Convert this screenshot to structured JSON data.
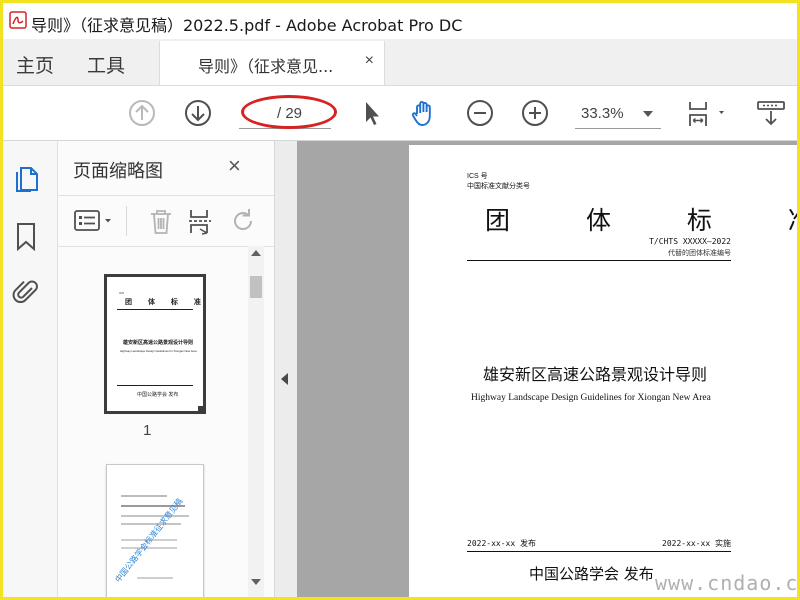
{
  "window": {
    "title": "导则》（征求意见稿）2022.5.pdf - Adobe Acrobat Pro DC"
  },
  "menubar": {
    "home_label": "主页",
    "tools_label": "工具",
    "doc_tab_label": "导则》（征求意见...",
    "doc_tab_close": "×"
  },
  "toolbar": {
    "page_total": "/ 29",
    "zoom_value": "33.3%"
  },
  "thumbnail_panel": {
    "title": "页面缩略图",
    "close": "×",
    "page_1_label": "1",
    "thumb1": {
      "title": "团 体 标 准",
      "doc_title": "雄安新区高速公路景观设计导则",
      "en_title": "Highway Landscape Design Guidelines for Xiongan New Area",
      "publisher": "中国公路学会 发布"
    },
    "thumb2": {
      "watermark": "中国公路学会标准征求意见稿"
    }
  },
  "document": {
    "ics_line": "ICS 号",
    "class_line": "中国标准文献分类号",
    "std_title": "团 体 标 准",
    "std_no": "T/CHTS XXXXX—2022",
    "std_no_note": "代替的团体标准编号",
    "main_title": "雄安新区高速公路景观设计导则",
    "english_title": "Highway Landscape Design Guidelines for Xiongan New Area",
    "issue_date": "2022-xx-xx 发布",
    "impl_date": "2022-xx-xx 实施",
    "publisher": "中国公路学会  发布"
  },
  "watermark": "www.cndao.com",
  "colors": {
    "frame": "#f2e321",
    "acrobat_red": "#d72222",
    "hand_blue": "#1f6fd1"
  }
}
